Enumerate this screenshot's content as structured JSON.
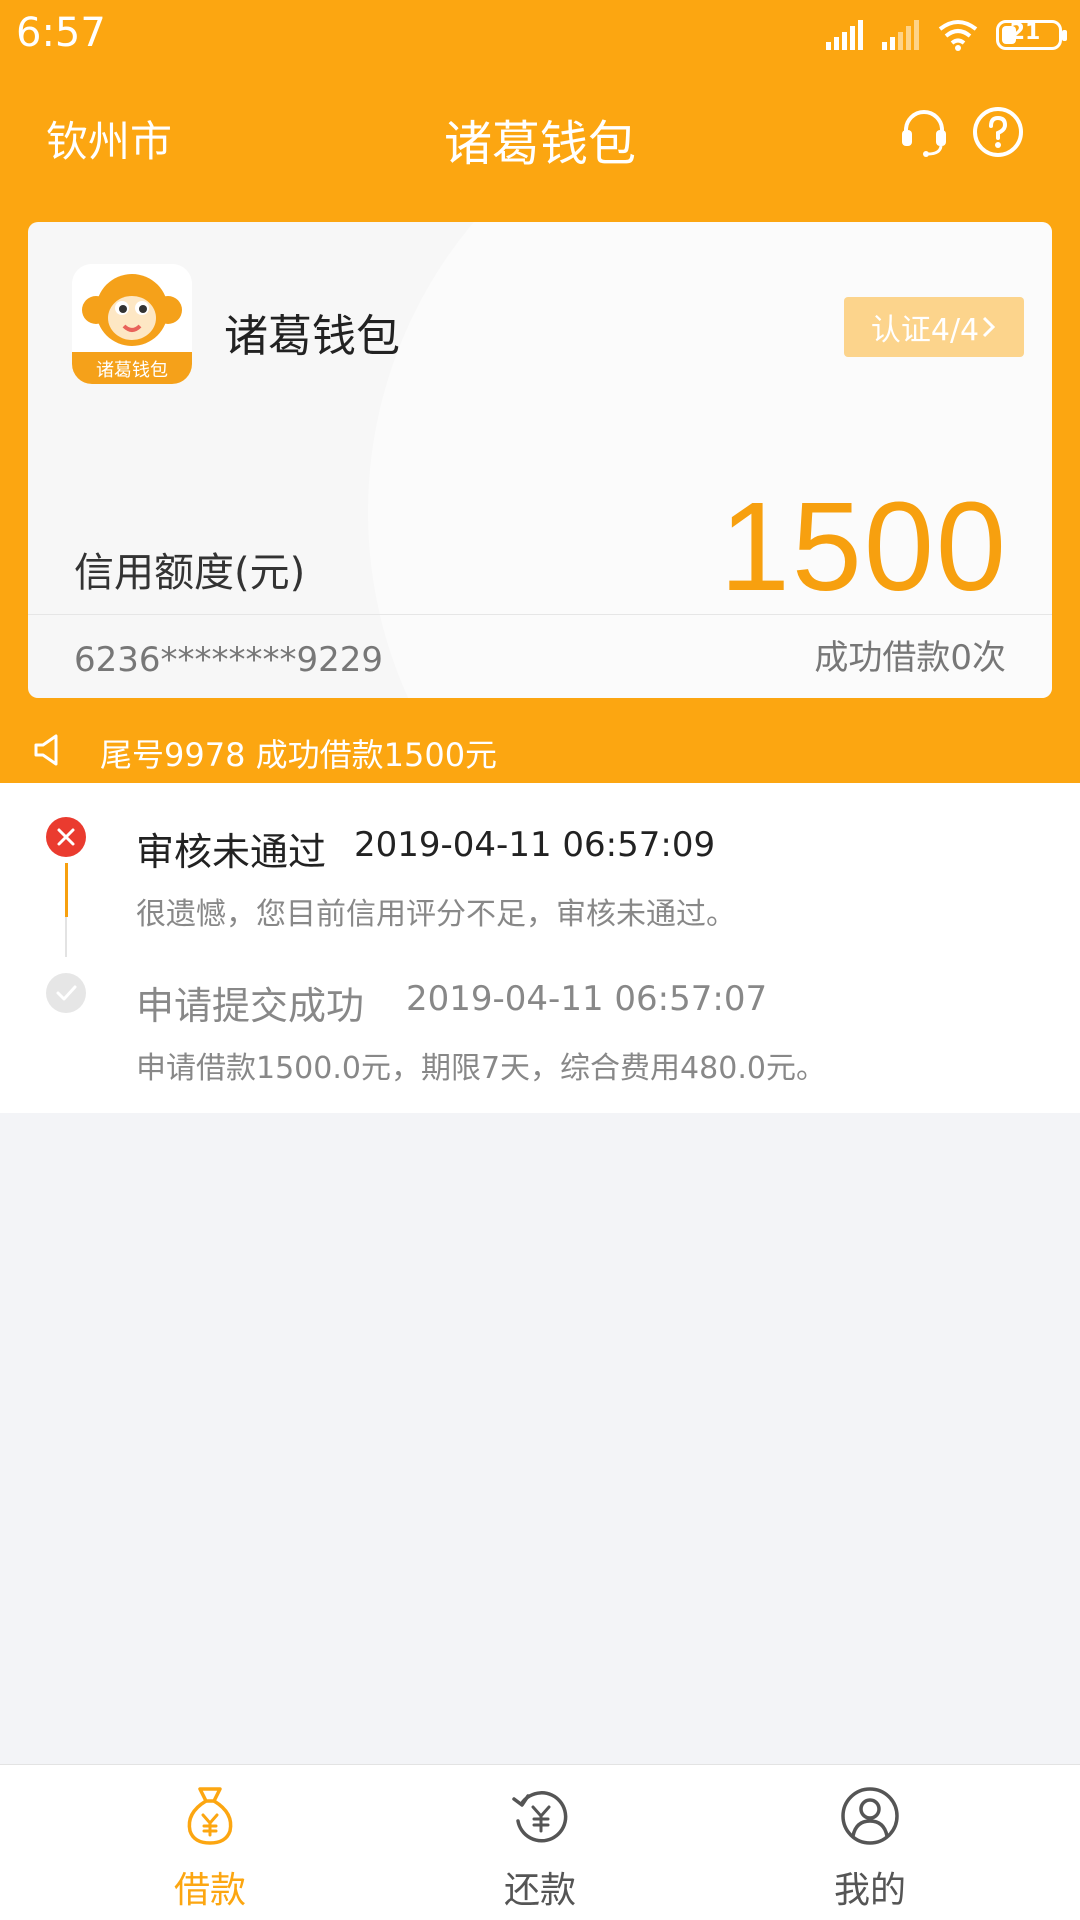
{
  "status_bar": {
    "time": "6:57",
    "battery_level": "21"
  },
  "nav": {
    "city": "钦州市",
    "title": "诸葛钱包"
  },
  "card": {
    "app_name": "诸葛钱包",
    "logo_text": "诸葛钱包",
    "verify_label": "认证4/4",
    "credit_label": "信用额度(元)",
    "credit_value": "1500",
    "card_number": "6236********9229",
    "loan_count": "成功借款0次"
  },
  "notice": {
    "text": "尾号9978 成功借款1500元"
  },
  "timeline": [
    {
      "status": "failed",
      "title": "审核未通过",
      "time": "2019-04-11 06:57:09",
      "desc": "很遗憾，您目前信用评分不足，审核未通过。"
    },
    {
      "status": "done",
      "title": "申请提交成功",
      "time": "2019-04-11 06:57:07",
      "desc": "申请借款1500.0元，期限7天，综合费用480.0元。"
    }
  ],
  "tabs": [
    {
      "label": "借款",
      "icon": "money-bag-icon",
      "active": true
    },
    {
      "label": "还款",
      "icon": "repay-icon",
      "active": false
    },
    {
      "label": "我的",
      "icon": "user-icon",
      "active": false
    }
  ],
  "colors": {
    "brand": "#fca611",
    "accent_text": "#f7a00f",
    "error": "#ea3b2f",
    "tab_inactive": "#555555"
  }
}
